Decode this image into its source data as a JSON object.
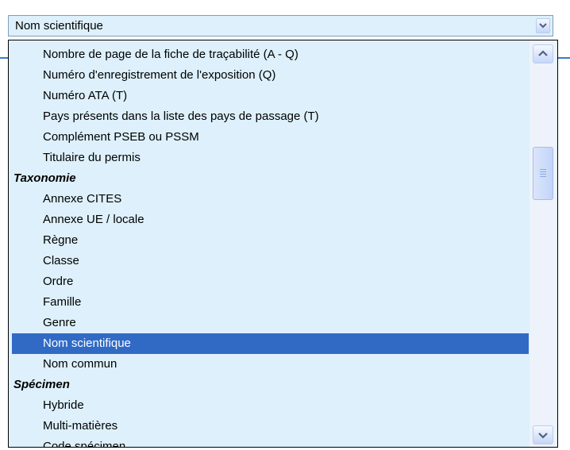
{
  "combo": {
    "value": "Nom scientifique",
    "icon": "chevron-down-icon"
  },
  "list": {
    "items": [
      {
        "label": "Nombre de page de la fiche de traçabilité (A - Q)",
        "type": "item"
      },
      {
        "label": "Numéro d'enregistrement de l'exposition (Q)",
        "type": "item"
      },
      {
        "label": "Numéro ATA (T)",
        "type": "item"
      },
      {
        "label": "Pays présents dans la liste des pays de passage (T)",
        "type": "item"
      },
      {
        "label": "Complément PSEB ou PSSM",
        "type": "item"
      },
      {
        "label": "Titulaire du permis",
        "type": "item"
      },
      {
        "label": "Taxonomie",
        "type": "group"
      },
      {
        "label": "Annexe CITES",
        "type": "item"
      },
      {
        "label": "Annexe UE / locale",
        "type": "item"
      },
      {
        "label": "Règne",
        "type": "item"
      },
      {
        "label": "Classe",
        "type": "item"
      },
      {
        "label": "Ordre",
        "type": "item"
      },
      {
        "label": "Famille",
        "type": "item"
      },
      {
        "label": "Genre",
        "type": "item"
      },
      {
        "label": "Nom scientifique",
        "type": "item",
        "selected": true
      },
      {
        "label": "Nom commun",
        "type": "item"
      },
      {
        "label": "Spécimen",
        "type": "group"
      },
      {
        "label": "Hybride",
        "type": "item"
      },
      {
        "label": "Multi-matières",
        "type": "item"
      },
      {
        "label": "Code spécimen",
        "type": "item"
      }
    ]
  },
  "colors": {
    "selection": "#316ac5",
    "list_background": "#ddf0fb",
    "accent": "#3a7bc8"
  }
}
